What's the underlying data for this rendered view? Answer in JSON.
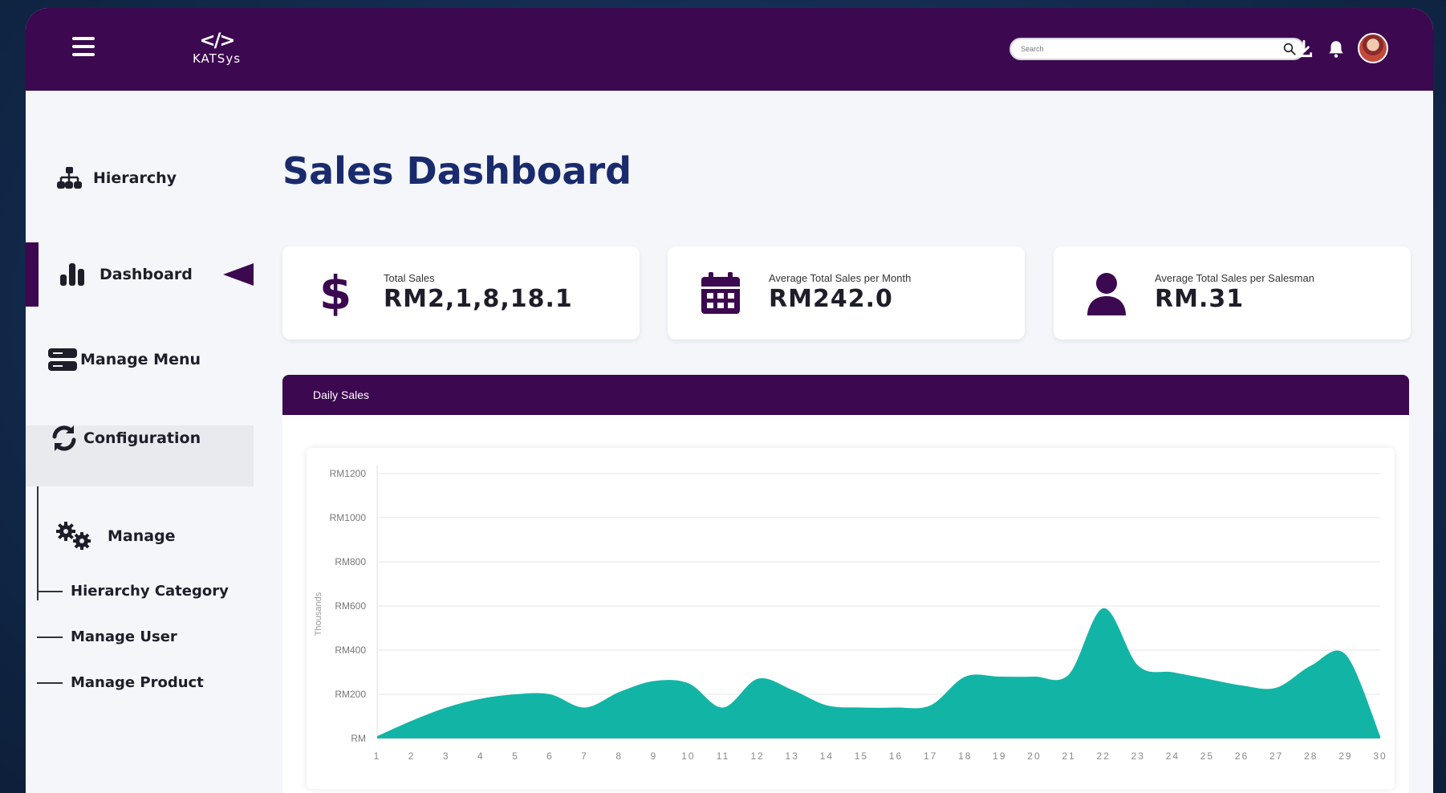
{
  "app": {
    "logo_text": "KATSys"
  },
  "topbar": {
    "search_placeholder": "Search"
  },
  "sidebar": {
    "items": [
      {
        "label": "Hierarchy",
        "icon": "sitemap-icon"
      },
      {
        "label": "Dashboard",
        "icon": "bar-chart-icon",
        "active": true
      },
      {
        "label": "Manage Menu",
        "icon": "server-icon"
      },
      {
        "label": "Configuration",
        "icon": "refresh-icon"
      },
      {
        "label": "Manage",
        "icon": "gears-icon"
      }
    ],
    "sub_items": [
      {
        "label": "Hierarchy Category"
      },
      {
        "label": "Manage User"
      },
      {
        "label": "Manage Product"
      }
    ]
  },
  "main": {
    "title": "Sales Dashboard",
    "kpis": [
      {
        "label": "Total Sales",
        "value": "RM2,1,8,18.1",
        "icon": "dollar-icon"
      },
      {
        "label": "Average Total Sales per Month",
        "value": "RM242.0",
        "icon": "calendar-icon"
      },
      {
        "label": "Average Total Sales per Salesman",
        "value": "RM.31",
        "icon": "user-icon"
      }
    ],
    "panel_title": "Daily Sales"
  },
  "colors": {
    "brand": "#3c0850",
    "accent": "#12b5a5",
    "title": "#1a2b6d"
  },
  "chart_data": {
    "type": "area",
    "ylabel": "Thousands",
    "y_tick_labels": [
      "RM",
      "RM200",
      "RM400",
      "RM600",
      "RM800",
      "RM1000",
      "RM1200"
    ],
    "y_ticks": [
      0,
      200,
      400,
      600,
      800,
      1000,
      1200
    ],
    "ylim": [
      0,
      1200
    ],
    "x": [
      1,
      2,
      3,
      4,
      5,
      6,
      7,
      8,
      9,
      10,
      11,
      12,
      13,
      14,
      15,
      16,
      17,
      18,
      19,
      20,
      21,
      22,
      23,
      24,
      25,
      26,
      27,
      28,
      29,
      30
    ],
    "values": [
      10,
      80,
      140,
      180,
      200,
      200,
      140,
      210,
      260,
      250,
      140,
      270,
      220,
      150,
      140,
      140,
      150,
      280,
      280,
      280,
      290,
      590,
      330,
      300,
      270,
      240,
      230,
      330,
      380,
      10
    ],
    "grid": true
  }
}
